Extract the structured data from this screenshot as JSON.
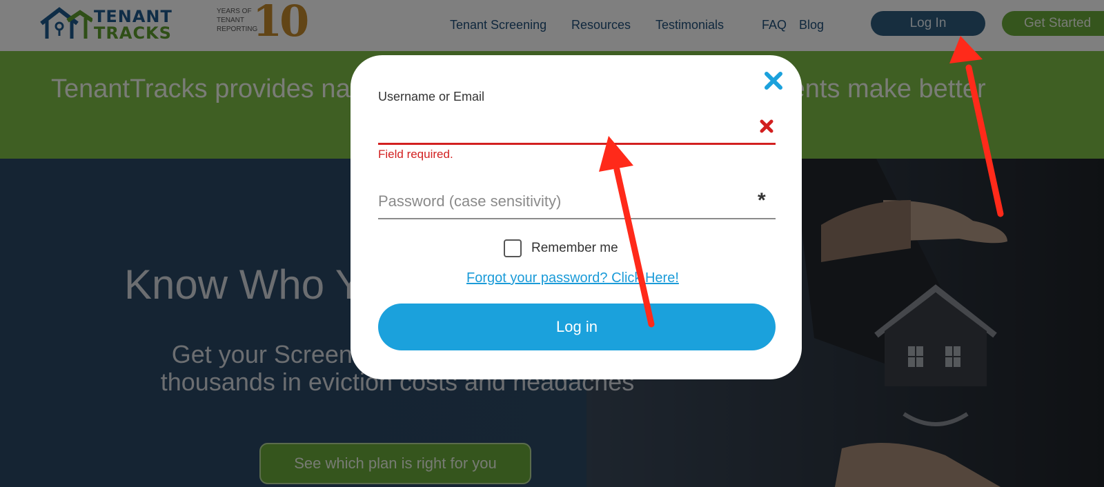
{
  "header": {
    "logo": {
      "line1": "TENANT",
      "line2a": "TRA",
      "line2b": "CKS"
    },
    "anniversary": {
      "line1": "YEARS OF",
      "line2": "TENANT",
      "line3": "REPORTING",
      "number": "10"
    },
    "nav": [
      "Tenant Screening",
      "Resources",
      "Testimonials",
      "FAQ",
      "Blog"
    ],
    "login_label": "Log In",
    "get_started_label": "Get Started"
  },
  "banner": {
    "text": "TenantTracks provides national tenant screening, helping our clients make better"
  },
  "hero": {
    "heading": "Know Who You're Renting To",
    "subheading": "Get your Screening done today and save thousands in eviction costs and headaches",
    "cta_label": "See which plan is right for you"
  },
  "modal": {
    "username_label": "Username or Email",
    "username_value": "",
    "error_text": "Field required.",
    "password_placeholder": "Password (case sensitivity)",
    "required_marker": "*",
    "remember_label": "Remember me",
    "remember_checked": false,
    "forgot_link": "Forgot your password? Click Here!",
    "login_button": "Log in"
  },
  "colors": {
    "brand_blue": "#1f5b8f",
    "brand_green": "#6aaa3a",
    "banner_green": "#7fbf47",
    "error_red": "#d21f1f",
    "primary_button": "#1ba1dc",
    "annotation_arrow": "#ff2a1a"
  }
}
